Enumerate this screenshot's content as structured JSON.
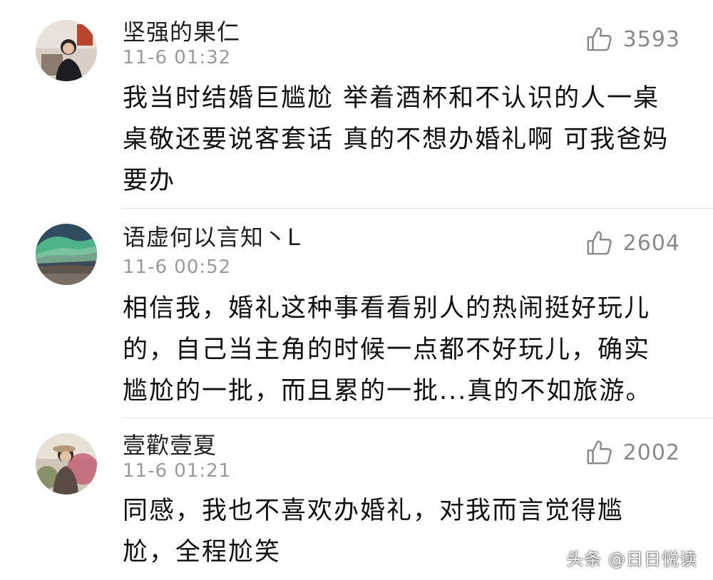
{
  "comments": [
    {
      "username": "坚强的果仁",
      "time": "11-6 01:32",
      "likes": "3593",
      "text": "我当时结婚巨尴尬 举着酒杯和不认识的人一桌桌敬还要说客套话 真的不想办婚礼啊 可我爸妈要办"
    },
    {
      "username": "语虚何以言知丶L",
      "time": "11-6 00:52",
      "likes": "2604",
      "text": "相信我，婚礼这种事看看别人的热闹挺好玩儿的，自己当主角的时候一点都不好玩儿，确实尴尬的一批，而且累的一批...真的不如旅游。"
    },
    {
      "username": "壹歡壹夏",
      "time": "11-6 01:21",
      "likes": "2002",
      "text": "同感，我也不喜欢办婚礼，对我而言觉得尴尬，全程尬笑"
    }
  ],
  "watermark": "头条 @日日悦读",
  "icons": {
    "like": "thumbs-up-icon"
  }
}
